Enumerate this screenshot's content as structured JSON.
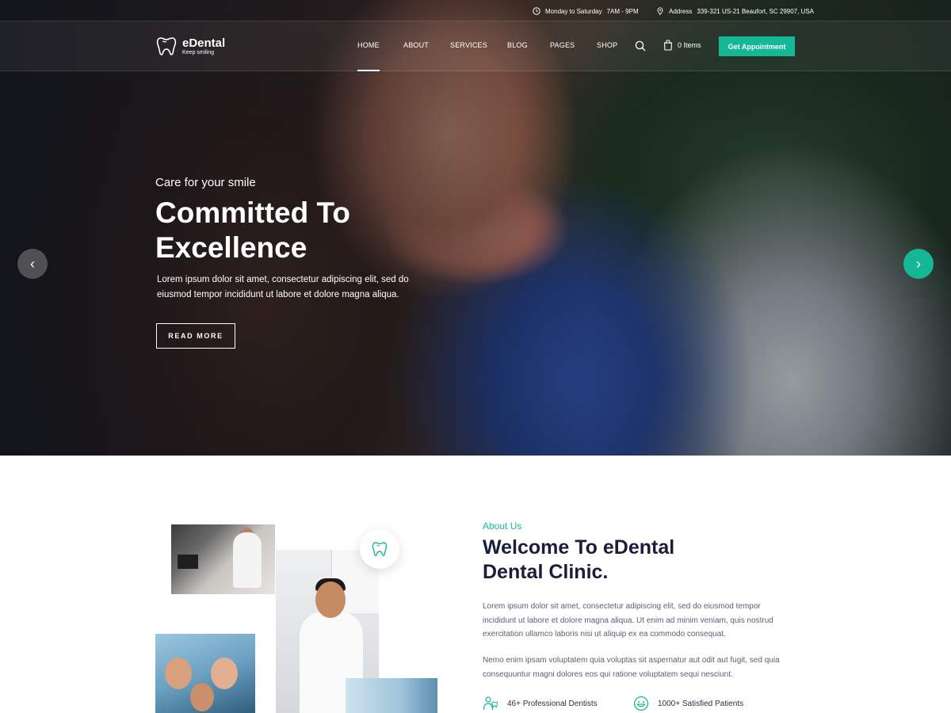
{
  "topbar": {
    "hours_label": "Monday to Saturday",
    "hours_value": "7AM - 9PM",
    "address_label": "Address",
    "address_value": "339-321 US-21 Beaufort, SC 29907, USA"
  },
  "brand": {
    "name": "eDental",
    "tagline": "Keep smiling"
  },
  "nav": {
    "items": [
      "HOME",
      "ABOUT",
      "SERVICES",
      "BLOG",
      "PAGES",
      "SHOP"
    ],
    "active": "HOME",
    "cart_label": "0 Items",
    "cta_label": "Get Appointment"
  },
  "hero": {
    "subtitle": "Care for your smile",
    "title_line1": "Committed To",
    "title_line2": "Excellence",
    "text": "Lorem ipsum dolor sit amet, consectetur adipiscing elit, sed do eiusmod tempor incididunt ut labore et dolore magna aliqua.",
    "button": "READ MORE",
    "prev_glyph": "‹",
    "next_glyph": "›"
  },
  "about": {
    "kicker": "About Us",
    "title_line1": "Welcome To eDental",
    "title_line2": "Dental Clinic.",
    "paragraph1": "Lorem ipsum dolor sit amet, consectetur adipiscing elit, sed do eiusmod tempor incididunt ut labore et dolore magna aliqua. Ut enim ad minim veniam, quis nostrud exercitation ullamco laboris nisi ut aliquip ex ea commodo consequat.",
    "paragraph2": "Nemo enim ipsam voluptatem quia voluptas sit aspernatur aut odit aut fugit, sed quia consequuntur magni dolores eos qui ratione voluptatem sequi nesciunt.",
    "feature1": "46+ Professional Dentists",
    "feature2": "1000+ Satisfied Patients"
  },
  "colors": {
    "accent": "#14b896",
    "heading": "#1a1e3c",
    "body_text": "#5b5f73"
  },
  "icons": [
    "clock-icon",
    "location-pin-icon",
    "tooth-logo-icon",
    "search-icon",
    "cart-icon",
    "chevron-left-icon",
    "chevron-right-icon",
    "tooth-badge-icon",
    "dentist-icon",
    "smile-icon"
  ]
}
